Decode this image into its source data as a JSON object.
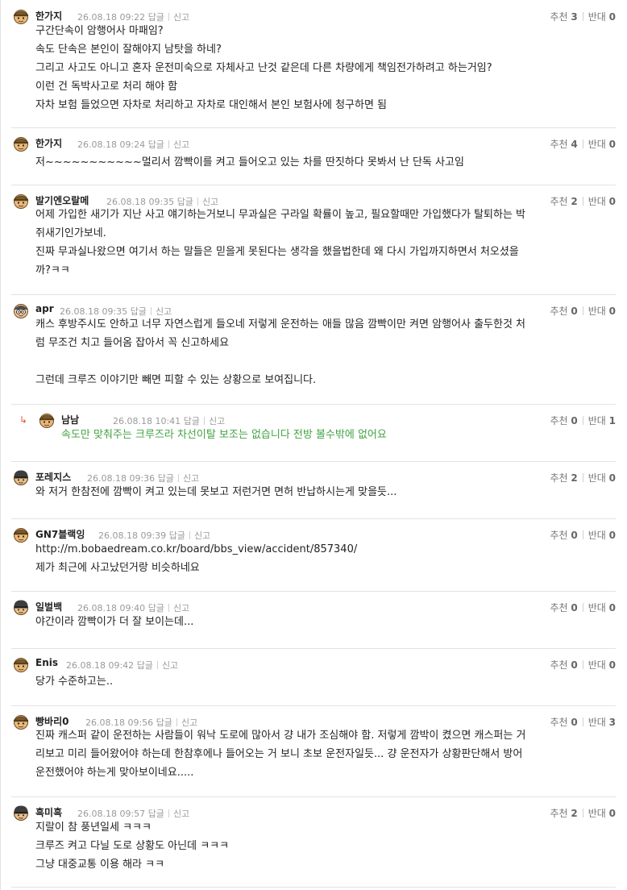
{
  "labels": {
    "reply": "답글",
    "report": "신고",
    "up": "추천",
    "down": "반대"
  },
  "colors": {
    "reply_text": "#43a243",
    "reply_arrow": "#e25b3c",
    "separator": "#e3e3e3"
  },
  "comments": [
    {
      "nick": "한가지",
      "date": "26.08.18 09:22",
      "up": "3",
      "down": "0",
      "avatar_icon": "cap-face-icon",
      "lines": [
        "구간단속이 암행어사 마패임?",
        "속도 단속은 본인이 잘해야지 남탓을 하네?",
        "그리고 사고도 아니고 혼자 운전미숙으로 자체사고 난것 같은데 다른 차량에게 책임전가하려고 하는거임?",
        "이런 건 독박사고로 처리 해야 함",
        "자차 보험 들었으면 자차로 처리하고 자차로 대인해서 본인 보험사에 청구하면 됨"
      ]
    },
    {
      "nick": "한가지",
      "date": "26.08.18 09:24",
      "up": "4",
      "down": "0",
      "avatar_icon": "cap-face-icon",
      "lines": [
        "저~~~~~~~~~~~멀리서 깜빡이를 켜고 들어오고 있는 차를 딴짓하다 못봐서 난 단독 사고임"
      ]
    },
    {
      "nick": "발기엔오랄메",
      "date": "26.08.18 09:35",
      "up": "2",
      "down": "0",
      "avatar_icon": "cap-face-icon",
      "lines": [
        "어제 가입한 새기가 지난 사고 얘기하는거보니 무과실은 구라일 확률이 높고, 필요할때만 가입했다가 탈퇴하는 박",
        "쥐새기인가보네.",
        "진짜 무과실나왔으면 여기서 하는 말들은 믿을게 못된다는 생각을 했을법한데 왜 다시 가입까지하면서 처오셨을",
        "까?ㅋㅋ"
      ]
    },
    {
      "nick": "apr",
      "date": "26.08.18 09:35",
      "up": "0",
      "down": "0",
      "avatar_icon": "glasses-face-icon",
      "lines": [
        "캐스 후방주시도 안하고 너무 자연스럽게 들오네 저렇게 운전하는 애들 많음 깜빡이만 켜면 암행어사 출두한것 처",
        "럼 무조건 치고 들어옴 잡아서 꼭 신고하세요",
        "",
        "그런데 크루즈 이야기만 빼면 피할 수 있는 상황으로 보여집니다."
      ]
    },
    {
      "nick": "남남",
      "date": "26.08.18 10:41",
      "up": "0",
      "down": "1",
      "reply": true,
      "avatar_icon": "cap-face-icon",
      "lines": [
        "속도만 맞춰주는 크루즈라 차선이탈 보조는 없습니다 전방 볼수밖에 없어요"
      ]
    },
    {
      "nick": "포레지스",
      "date": "26.08.18 09:36",
      "up": "2",
      "down": "0",
      "avatar_icon": "helmet-face-icon",
      "lines": [
        "와 저거 한참전에 깜빡이 켜고 있는데 못보고 저런거면 면허 반납하시는게 맞을듯..."
      ]
    },
    {
      "nick": "GN7블랙잉",
      "date": "26.08.18 09:39",
      "up": "0",
      "down": "0",
      "avatar_icon": "cap-face-icon",
      "lines": [
        "http://m.bobaedream.co.kr/board/bbs_view/accident/857340/",
        "제가 최근에 사고났던거랑 비슷하네요"
      ]
    },
    {
      "nick": "일벌백",
      "date": "26.08.18 09:40",
      "up": "0",
      "down": "0",
      "avatar_icon": "helmet-face-icon",
      "lines": [
        "야간이라 깜빡이가 더 잘 보이는데..."
      ]
    },
    {
      "nick": "Enis",
      "date": "26.08.18 09:42",
      "up": "0",
      "down": "0",
      "avatar_icon": "cap-face-icon",
      "lines": [
        "당가 수준하고는.."
      ]
    },
    {
      "nick": "빵바리0",
      "date": "26.08.18 09:56",
      "up": "0",
      "down": "3",
      "avatar_icon": "cap-face-icon",
      "lines": [
        "진짜 캐스퍼 같이 운전하는 사람들이 워낙 도로에 많아서 걍 내가 조심해야 함. 저렇게 깜박이 켰으면 캐스퍼는 거",
        "리보고 미리 들어왔어야 하는데 한참후에나 들어오는 거 보니 초보 운전자일듯... 걍 운전자가 상황판단해서 방어",
        "운전했어야 하는게 맞아보이네요....."
      ]
    },
    {
      "nick": "흑미흑",
      "date": "26.08.18 09:57",
      "up": "2",
      "down": "0",
      "avatar_icon": "helmet-face-icon",
      "lines": [
        "지랄이 참 풍년일세 ㅋㅋㅋ",
        "크루즈 켜고 다닐 도로 상황도 아닌데 ㅋㅋㅋ",
        "그냥 대중교통 이용 해라 ㅋㅋ"
      ]
    }
  ]
}
